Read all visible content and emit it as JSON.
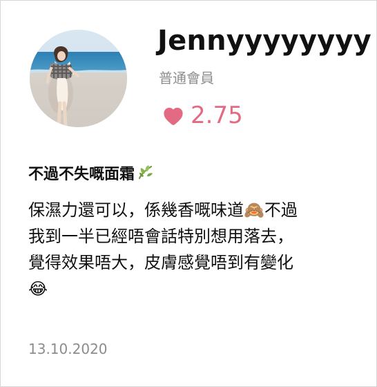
{
  "profile": {
    "username": "Jennyyyyyyyy",
    "member_level": "普通會員",
    "rating": "2.75"
  },
  "review": {
    "title": "不過不失嘅面霜",
    "title_emoji": "🌿",
    "body": "保濕力還可以，係幾香嘅味道🙈不過\n我到一半已經唔會話特別想用落去，\n覺得效果唔大，皮膚感覺唔到有變化\n😂",
    "date": "13.10.2020"
  },
  "icons": {
    "avatar": "avatar",
    "rating_icon": "heart-icon",
    "title_icon": "leaf-icon"
  },
  "colors": {
    "accent": "#e36a83",
    "text_primary": "#111111",
    "text_secondary": "#8c8c8c",
    "border": "#d6d6d6"
  }
}
